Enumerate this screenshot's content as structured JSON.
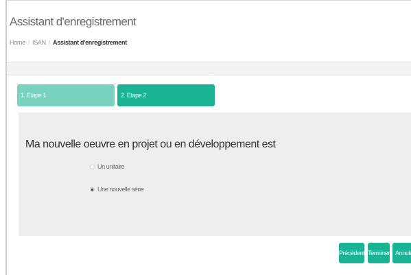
{
  "header": {
    "title": "Assistant d'enregistrement",
    "breadcrumb": [
      "Home",
      "ISAN",
      "Assistant d'enregistrement"
    ]
  },
  "wizard": {
    "steps": [
      {
        "label": "1. Etape 1",
        "state": "done"
      },
      {
        "label": "2. Etape 2",
        "state": "current"
      }
    ],
    "question": "Ma nouvelle oeuvre en projet ou en développement est",
    "options": [
      {
        "label": "Un unitaire",
        "selected": false
      },
      {
        "label": "Une nouvelle série",
        "selected": true
      }
    ]
  },
  "actions": {
    "previous": "Précédent",
    "finish": "Terminer",
    "cancel": "Annuler"
  },
  "colors": {
    "accent": "#1ab394",
    "accent_light": "#79d2be",
    "panel": "#eeeeee"
  }
}
